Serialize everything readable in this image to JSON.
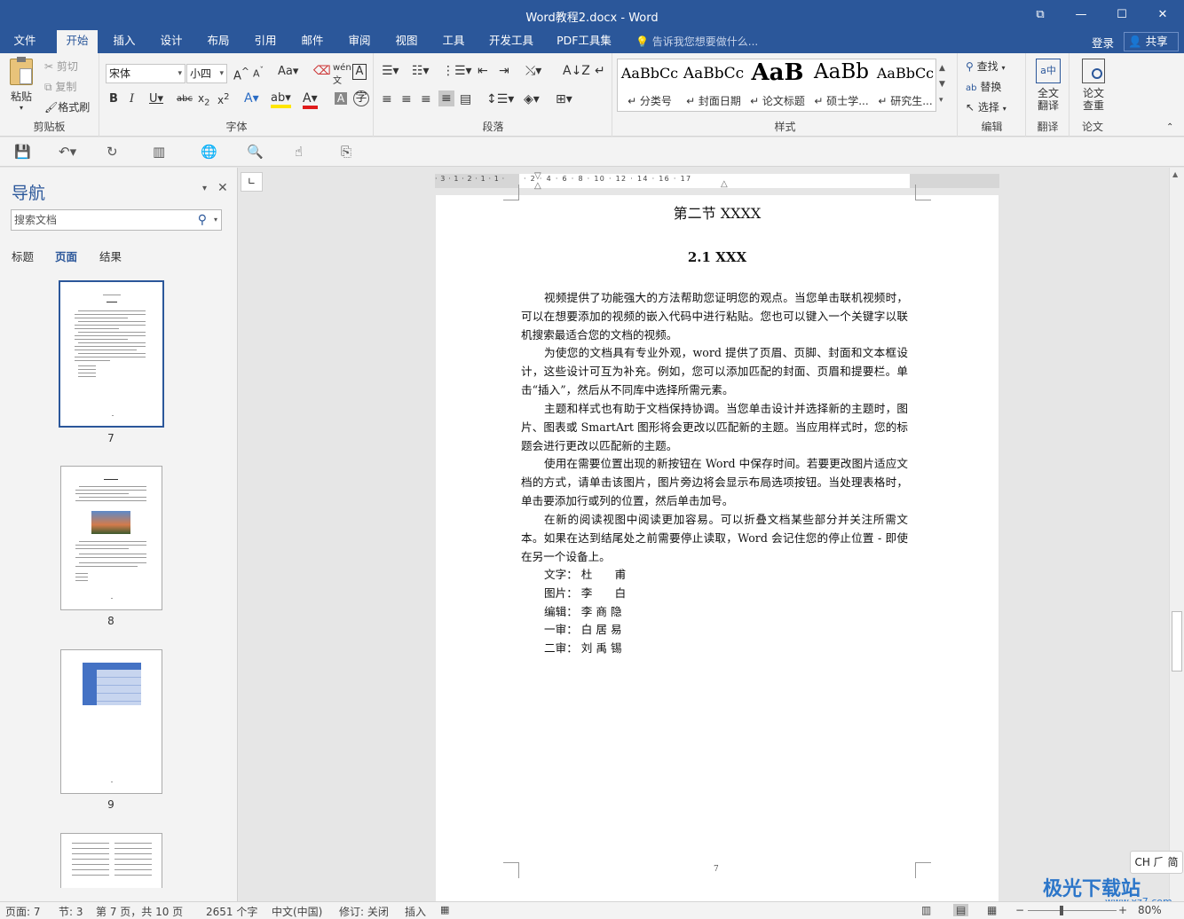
{
  "window": {
    "title": "Word教程2.docx - Word",
    "buttons": [
      "⧉",
      "—",
      "☐",
      "✕"
    ]
  },
  "menu": {
    "tabs": [
      "文件",
      "开始",
      "插入",
      "设计",
      "布局",
      "引用",
      "邮件",
      "审阅",
      "视图",
      "工具",
      "开发工具",
      "PDF工具集"
    ],
    "active": "开始",
    "tellme": "告诉我您想要做什么...",
    "login": "登录",
    "share": "共享"
  },
  "ribbon": {
    "clipboard": {
      "label": "剪贴板",
      "paste": "粘贴",
      "cut": "剪切",
      "copy": "复制",
      "format_painter": "格式刷"
    },
    "font": {
      "label": "字体",
      "font_name": "宋体",
      "font_size": "小四"
    },
    "paragraph": {
      "label": "段落"
    },
    "styles": {
      "label": "样式",
      "items": [
        {
          "sample": "AaBbCc",
          "name": "↵ 分类号"
        },
        {
          "sample": "AaBbCc",
          "name": "↵ 封面日期"
        },
        {
          "sample": "AaB",
          "name": "↵ 论文标题"
        },
        {
          "sample": "AaBb",
          "name": "↵ 硕士学..."
        },
        {
          "sample": "AaBbCc",
          "name": "↵ 研究生..."
        }
      ]
    },
    "editing": {
      "label": "编辑",
      "find": "查找",
      "replace": "替换",
      "select": "选择"
    },
    "translate": {
      "label": "翻译",
      "full": "全文翻译"
    },
    "paper": {
      "label": "论文",
      "check": "论文查重"
    }
  },
  "nav": {
    "title": "导航",
    "search_placeholder": "搜索文档",
    "tabs": [
      "标题",
      "页面",
      "结果"
    ],
    "active_tab": "页面",
    "pages": [
      "7",
      "8",
      "9"
    ]
  },
  "document": {
    "heading1": "第二节 XXXX",
    "heading2": "2.1 XXX",
    "paragraphs": [
      "视频提供了功能强大的方法帮助您证明您的观点。当您单击联机视频时，可以在想要添加的视频的嵌入代码中进行粘贴。您也可以键入一个关键字以联机搜索最适合您的文档的视频。",
      "为使您的文档具有专业外观，word 提供了页眉、页脚、封面和文本框设计，这些设计可互为补充。例如，您可以添加匹配的封面、页眉和提要栏。单击“插入”，然后从不同库中选择所需元素。",
      "主题和样式也有助于文档保持协调。当您单击设计并选择新的主题时，图片、图表或 SmartArt 图形将会更改以匹配新的主题。当应用样式时，您的标题会进行更改以匹配新的主题。",
      "使用在需要位置出现的新按钮在 Word 中保存时间。若要更改图片适应文档的方式，请单击该图片，图片旁边将会显示布局选项按钮。当处理表格时，单击要添加行或列的位置，然后单击加号。",
      "在新的阅读视图中阅读更加容易。可以折叠文档某些部分并关注所需文本。如果在达到结尾处之前需要停止读取，Word 会记住您的停止位置 - 即使在另一个设备上。"
    ],
    "credits": [
      {
        "role": "文字：",
        "name": "杜　　甫"
      },
      {
        "role": "图片：",
        "name": "李　　白"
      },
      {
        "role": "编辑：",
        "name": "李 商 隐"
      },
      {
        "role": "一审：",
        "name": "白 居 易"
      },
      {
        "role": "二审：",
        "name": "刘 禹 锡"
      }
    ],
    "page_number": "7",
    "ruler_left_marks": "· 3 · 1 · 2 · 1 · 1 ·",
    "ruler_right_marks": "· 2 · 4 · 6 · 8 · 10 · 12 · 14 · 16 · 17"
  },
  "ime": "CH ⺁ 简",
  "watermark": {
    "name": "极光下载站",
    "url": "www.xz7.com"
  },
  "status": {
    "page": "页面: 7",
    "section": "节: 3",
    "page_of": "第 7 页，共 10 页",
    "words": "2651 个字",
    "language": "中文(中国)",
    "revision": "修订: 关闭",
    "mode": "插入",
    "zoom": "80%"
  }
}
